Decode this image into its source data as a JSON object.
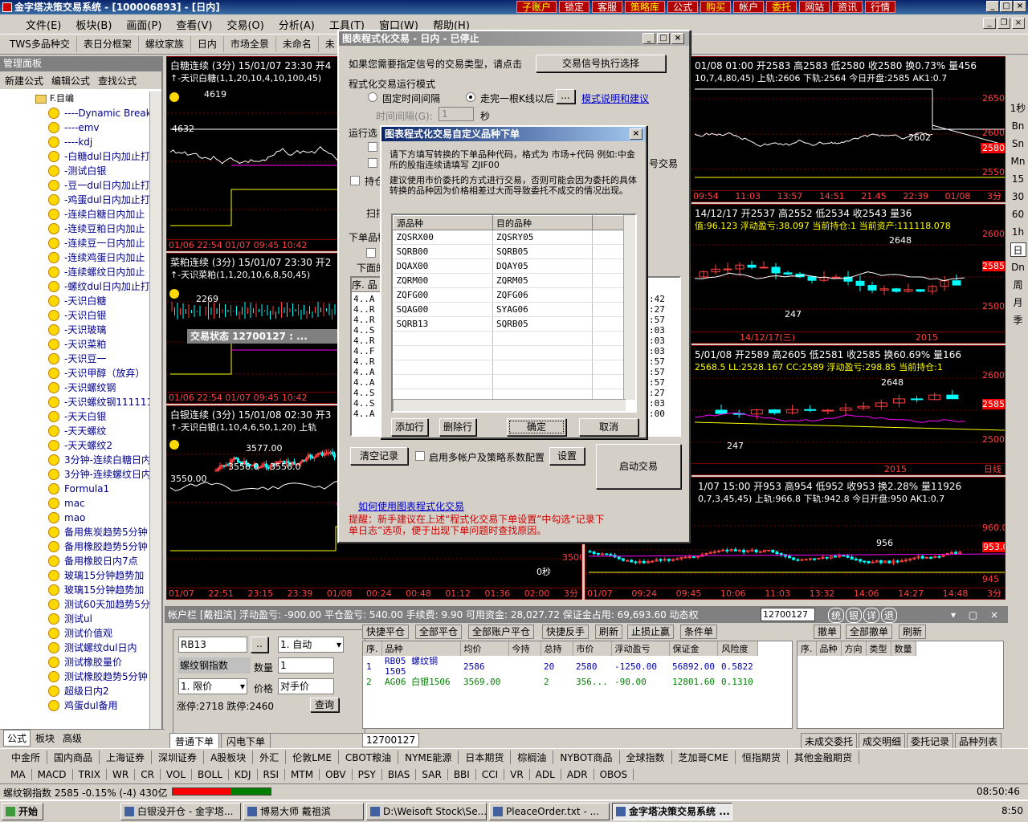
{
  "app": {
    "title": "金字塔决策交易系统 - [100006893] - [日内]",
    "top_buttons": [
      "子账户",
      "锁定",
      "客服",
      "策略库",
      "公式",
      "购买",
      "帐户",
      "委托",
      "网站",
      "资讯",
      "行情"
    ],
    "menu": [
      "文件(E)",
      "板块(B)",
      "画面(P)",
      "查看(V)",
      "交易(O)",
      "分析(A)",
      "工具(T)",
      "窗口(W)",
      "帮助(H)"
    ],
    "toolbar": [
      "TWS多品种交",
      "表日分框架",
      "螺纹家族",
      "日内",
      "市场全景",
      "未命名",
      "未"
    ]
  },
  "panel": {
    "title": "管理面板",
    "tools": [
      "新建公式",
      "编辑公式",
      "查找公式"
    ],
    "root": "F.目编",
    "items": [
      "----Dynamic Break",
      "----emv",
      "----kdj",
      "-白糖dul日内加止打",
      "-测试白银",
      "-豆一dul日内加止打",
      "-鸡蛋dul日内加止打",
      "-连续白糖日内加止",
      "-连续豆粕日内加止",
      "-连续豆一日内加止",
      "-连续鸡蛋日内加止",
      "-连续螺纹日内加止",
      "-螺纹dul日内加止打",
      "-天识白糖",
      "-天识白银",
      "-天识玻璃",
      "-天识菜粕",
      "-天识豆一",
      "-天识甲醇（放弃）",
      "-天识螺纹钢",
      "-天识螺纹钢111111",
      "-天天白银",
      "-天天螺纹",
      "-天天螺纹2",
      "3分钟-连续白糖日内",
      "3分钟-连续螺纹日内",
      "Formula1",
      "mac",
      "mao",
      "备用焦炭趋势5分钟",
      "备用橡胶趋势5分钟",
      "备用橡胶日内7点",
      "玻璃15分钟趋势加",
      "玻璃15分钟趋势加",
      "测试60天加趋势5分",
      "测试ul",
      "测试价值观",
      "测试螺纹dul日内",
      "测试橡胶量价",
      "测试橡胶趋势5分钟",
      "超级日内2",
      "鸡蛋dul备用"
    ],
    "tabs": [
      "公式",
      "板块",
      "高级"
    ]
  },
  "charts": {
    "c1": {
      "title": "白糖连续 (3分) 15/01/07 23:30 开4",
      "sub": "↑-天识白糖(1,1,20,10,4,10,100,45)",
      "axis": [
        "01/06 22:54",
        "01/07",
        "09:45",
        "10:42"
      ],
      "labels": [
        "4632",
        "4619"
      ]
    },
    "c2": {
      "title": "菜粕连续 (3分) 15/01/07 23:30 开2",
      "sub": "↑-天识菜粕(1,1,20,10,6,8,50,45)",
      "axis": [
        "01/06 22:54",
        "01/07",
        "09:45",
        "10:42"
      ],
      "labels": [
        "2269"
      ]
    },
    "c3": {
      "title": "白银连续 (3分) 15/01/08 02:30 开3",
      "sub": "↑-天识白银(1,10,4,6,50,1,20) 上轨",
      "axis": [
        "01/07",
        "22:51",
        "23:15",
        "23:39",
        "01/08",
        "00:24",
        "00:48",
        "01:12",
        "01:36",
        "02:00",
        "3分"
      ],
      "labels": [
        "3577.00",
        "3556.0",
        "3550.00",
        "3556.0",
        "3500",
        "0秒"
      ]
    },
    "r1": {
      "title": "01/08 01:00 开2583 高2583 低2580 收2580 换0.73% 量456",
      "sub": "10,7,4,80,45) 上轨:2606 下轨:2564 今日开盘:2585 AK1:0.7",
      "axis": [
        "09:54",
        "11:03",
        "13:57",
        "14:51",
        "21.45",
        "22:39",
        "01/08",
        "3分"
      ],
      "labels": [
        "2650",
        "2602",
        "2600",
        "2580",
        "2550"
      ]
    },
    "r2": {
      "title": "14/12/17 开2537 高2552 低2534 收2543 量36",
      "sub": "值:96.123 浮动盈亏:38.097 当前持仓:1 当前资产:111118.078",
      "axis": [
        "14/12/17(三)",
        "2015"
      ],
      "labels": [
        "2648",
        "2600",
        "2585",
        "2500",
        "247"
      ]
    },
    "r3": {
      "title": "5/01/08 开2589 高2605 低2581 收2585 换60.69% 量166",
      "sub": "2568.5 LL:2528.167 CC:2589 浮动盈亏:298.85 当前持仓:1",
      "axis": [
        "2015",
        "日线"
      ],
      "labels": [
        "2648",
        "2600",
        "2585",
        "2500",
        "247"
      ]
    },
    "r4": {
      "title": "1/07 15:00 开953 高954 低952 收953 换2.28% 量11926",
      "sub": "0,7,3,45,45) 上轨:966.8 下轨:942.8 今日开盘:950 AK1:0.7",
      "axis": [
        "01/07",
        "09:24",
        "09:45",
        "10:06",
        "11:03",
        "13:32",
        "14:06",
        "14:27",
        "14:48",
        "3分"
      ],
      "labels": [
        "960.0",
        "956",
        "953.0",
        "945"
      ]
    }
  },
  "periods": [
    "1秒",
    "Bn",
    "Sn",
    "Mn",
    "15",
    "30",
    "60",
    "1h",
    "日",
    "Dn",
    "周",
    "月",
    "季"
  ],
  "main_dialog": {
    "title": "图表程式化交易 - 日内 - 已停止",
    "prompt": "如果您需要指定信号的交易类型，请点击",
    "signal_btn": "交易信号执行选择",
    "mode_title": "程式化交易运行模式",
    "opt_fixed": "固定时间间隔",
    "opt_bar": "走完一根K线以后",
    "more": "...",
    "mode_link": "模式说明和建议",
    "interval_label": "时间间隔(G):",
    "interval_val": "1",
    "sec": "秒",
    "run_label": "运行选",
    "hold": "持仓",
    "scan": "扫描",
    "order_label": "下单品种",
    "below": "下面的",
    "log_header": [
      "序.",
      "品"
    ],
    "log_rows": [
      "4..A",
      "4..R",
      "4..R",
      "4..S",
      "4..R",
      "4..F",
      "4..R",
      "4..A",
      "4..A",
      "4..S",
      "4..S",
      "4..A"
    ],
    "log_times": [
      ":42",
      ":27",
      ":57",
      ":03",
      ":03",
      ":03",
      ":57",
      ":57",
      ":57",
      ":27",
      ":03",
      ":00"
    ],
    "clear": "清空记录",
    "multi": "启用多帐户及策略系数配置",
    "settings": "设置",
    "start": "启动交易",
    "help_link": "如何使用图表程式化交易",
    "tip": "提醒：新手建议在上述“程式化交易下单设置”中勾选“记录下单日志”选项，便于出现下单问题时查找原因。",
    "partial_right": "号交易"
  },
  "sub_dialog": {
    "title": "图表程式化交易自定义品种下单",
    "desc1": "请下方填写转换的下单品种代码，格式为 市场+代码 例如:中金所的股指连续请填写 ZJIF00",
    "desc2": "建议使用市价委托的方式进行交易，否则可能会因为委托的具体转换的品种因为价格相差过大而导致委托不成交的情况出现。",
    "col_src": "源品种",
    "col_dst": "目的品种",
    "rows": [
      [
        "ZQSRX00",
        "ZQSRY05"
      ],
      [
        "SQRB00",
        "SQRB05"
      ],
      [
        "DQAX00",
        "DQAY05"
      ],
      [
        "ZQRM00",
        "ZQRM05"
      ],
      [
        "ZQFG00",
        "ZQFG06"
      ],
      [
        "SQAG00",
        "SYAG06"
      ],
      [
        "SQRB13",
        "SQRB05"
      ]
    ],
    "add": "添加行",
    "del": "删除行",
    "ok": "确定",
    "cancel": "取消"
  },
  "status_float": {
    "title": "交易状态 12700127 : ..."
  },
  "account": {
    "bar": "帐户栏 [戴祖滨] 浮动盈亏: -900.00  平仓盈亏: 540.00  手续费: 9.90  可用资金: 28,027.72  保证金占用: 69,693.60  动态权",
    "acct_sel": "12700127",
    "side_btns": [
      "统",
      "银",
      "详",
      "退"
    ],
    "symbol": "RB13",
    "symbol_btn": "..",
    "mode": "1. 自动",
    "name": "螺纹钢指数",
    "qty_label": "数量",
    "qty": "1",
    "price_type": "1. 限价",
    "price_label": "价格",
    "price": "对手价",
    "limits": "涨停:2718 跌停:2460",
    "query": "查询",
    "left_tabs": [
      "普通下单",
      "闪电下单"
    ],
    "actions": [
      "快捷平仓",
      "全部平仓",
      "全部账户平仓",
      "快捷反手",
      "刷新",
      "止损止赢",
      "条件单"
    ],
    "pos_headers": [
      "序.",
      "品种",
      "均价",
      "今持",
      "总持",
      "市价",
      "浮动盈亏",
      "保证金",
      "风险度"
    ],
    "positions": [
      [
        "1",
        "RB05 螺纹钢1505",
        "2586",
        "",
        "20",
        "2580",
        "-1250.00",
        "56892.00",
        "0.5822"
      ],
      [
        "2",
        "AG06 白银1506",
        "3569.00",
        "",
        "2",
        "356...",
        "-90.00",
        "12801.60",
        "0.1310"
      ]
    ],
    "acct_tab": "12700127",
    "right_actions": [
      "撤单",
      "全部撤单",
      "刷新"
    ],
    "order_headers": [
      "序.",
      "品种",
      "方向",
      "类型",
      "数量"
    ],
    "right_tabs": [
      "未成交委托",
      "成交明细",
      "委托记录",
      "品种列表"
    ]
  },
  "quotes": [
    "中金所",
    "国内商品",
    "上海证券",
    "深圳证券",
    "A股板块",
    "外汇",
    "伦敦LME",
    "CBOT粮油",
    "NYME能源",
    "日本期货",
    "棕榈油",
    "NYBOT商品",
    "全球指数",
    "芝加哥CME",
    "恒指期货",
    "其他金融期货"
  ],
  "indicators": [
    "MA",
    "MACD",
    "TRIX",
    "WR",
    "CR",
    "VOL",
    "BOLL",
    "KDJ",
    "RSI",
    "MTM",
    "OBV",
    "PSY",
    "BIAS",
    "SAR",
    "BBI",
    "CCI",
    "VR",
    "ADL",
    "ADR",
    "OBOS"
  ],
  "status": {
    "ticker": "螺纹钢指数 2585 -0.15% (-4) 430亿",
    "time": "08:50:46"
  },
  "taskbar": {
    "start": "开始",
    "items": [
      "白银没开仓 - 金字塔...",
      "博易大师 戴祖滨",
      "D:\\Weisoft Stock\\Se...",
      "PleaceOrder.txt - ...",
      "金字塔决策交易系统 ..."
    ],
    "clock": "8:50"
  }
}
